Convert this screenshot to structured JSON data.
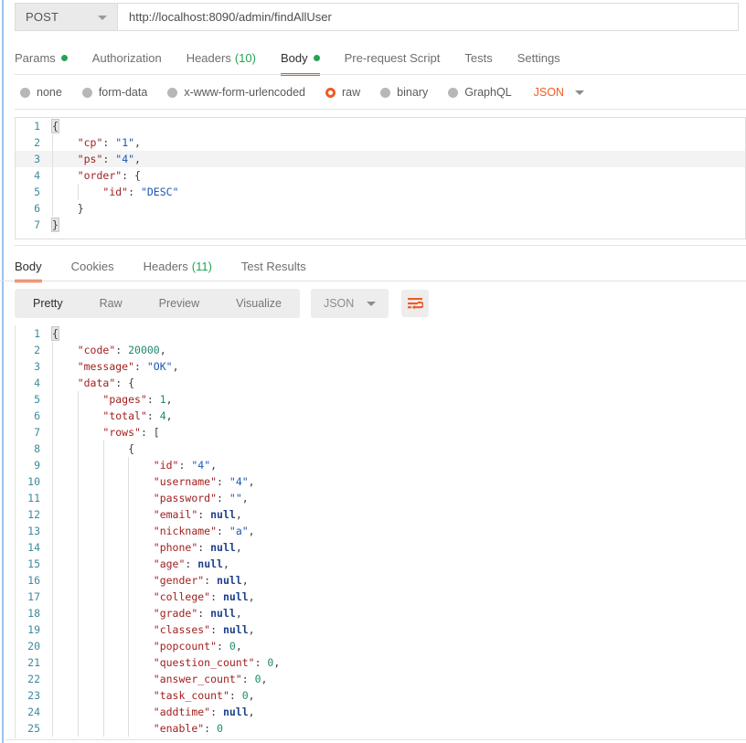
{
  "request": {
    "method": "POST",
    "method_icon": "chevron-down-icon",
    "url": "http://localhost:8090/admin/findAllUser",
    "tabs": [
      {
        "label": "Params",
        "dot": true,
        "active": false
      },
      {
        "label": "Authorization",
        "dot": false,
        "active": false
      },
      {
        "label": "Headers",
        "count": "(10)",
        "dot": false,
        "active": false
      },
      {
        "label": "Body",
        "dot": true,
        "active": true
      },
      {
        "label": "Pre-request Script",
        "dot": false,
        "active": false
      },
      {
        "label": "Tests",
        "dot": false,
        "active": false
      },
      {
        "label": "Settings",
        "dot": false,
        "active": false
      }
    ],
    "body_types": [
      {
        "label": "none",
        "selected": false
      },
      {
        "label": "form-data",
        "selected": false
      },
      {
        "label": "x-www-form-urlencoded",
        "selected": false
      },
      {
        "label": "raw",
        "selected": true
      },
      {
        "label": "binary",
        "selected": false
      },
      {
        "label": "GraphQL",
        "selected": false
      }
    ],
    "format": "JSON",
    "format_icon": "chevron-down-icon",
    "body_lines": [
      {
        "n": "1",
        "active": false,
        "guides": 0,
        "tokens": [
          {
            "t": "{",
            "c": "box"
          }
        ]
      },
      {
        "n": "2",
        "active": false,
        "guides": 1,
        "tokens": [
          {
            "t": "    ",
            "c": "p"
          },
          {
            "t": "\"cp\"",
            "c": "k"
          },
          {
            "t": ": ",
            "c": "p"
          },
          {
            "t": "\"1\"",
            "c": "s"
          },
          {
            "t": ",",
            "c": "p"
          }
        ]
      },
      {
        "n": "3",
        "active": true,
        "guides": 1,
        "tokens": [
          {
            "t": "    ",
            "c": "p"
          },
          {
            "t": "\"ps\"",
            "c": "k"
          },
          {
            "t": ": ",
            "c": "p"
          },
          {
            "t": "\"4\"",
            "c": "s"
          },
          {
            "t": ",",
            "c": "p"
          }
        ]
      },
      {
        "n": "4",
        "active": false,
        "guides": 1,
        "tokens": [
          {
            "t": "    ",
            "c": "p"
          },
          {
            "t": "\"order\"",
            "c": "k"
          },
          {
            "t": ": {",
            "c": "p"
          }
        ]
      },
      {
        "n": "5",
        "active": false,
        "guides": 2,
        "tokens": [
          {
            "t": "        ",
            "c": "p"
          },
          {
            "t": "\"id\"",
            "c": "k"
          },
          {
            "t": ": ",
            "c": "p"
          },
          {
            "t": "\"DESC\"",
            "c": "s"
          }
        ]
      },
      {
        "n": "6",
        "active": false,
        "guides": 1,
        "tokens": [
          {
            "t": "    ",
            "c": "p"
          },
          {
            "t": "}",
            "c": "p"
          }
        ]
      },
      {
        "n": "7",
        "active": false,
        "guides": 0,
        "tokens": [
          {
            "t": "}",
            "c": "box"
          }
        ]
      }
    ]
  },
  "response": {
    "tabs": [
      {
        "label": "Body",
        "active": true
      },
      {
        "label": "Cookies",
        "active": false
      },
      {
        "label": "Headers",
        "count": "(11)",
        "active": false
      },
      {
        "label": "Test Results",
        "active": false
      }
    ],
    "view_modes": [
      {
        "label": "Pretty",
        "active": true
      },
      {
        "label": "Raw",
        "active": false
      },
      {
        "label": "Preview",
        "active": false
      },
      {
        "label": "Visualize",
        "active": false
      }
    ],
    "format": "JSON",
    "format_icon": "chevron-down-icon",
    "wrap_icon": "word-wrap-icon",
    "body_lines": [
      {
        "n": "1",
        "guides": 0,
        "tokens": [
          {
            "t": "{",
            "c": "box"
          }
        ]
      },
      {
        "n": "2",
        "guides": 1,
        "tokens": [
          {
            "t": "    ",
            "c": "p"
          },
          {
            "t": "\"code\"",
            "c": "k"
          },
          {
            "t": ": ",
            "c": "p"
          },
          {
            "t": "20000",
            "c": "n"
          },
          {
            "t": ",",
            "c": "p"
          }
        ]
      },
      {
        "n": "3",
        "guides": 1,
        "tokens": [
          {
            "t": "    ",
            "c": "p"
          },
          {
            "t": "\"message\"",
            "c": "k"
          },
          {
            "t": ": ",
            "c": "p"
          },
          {
            "t": "\"OK\"",
            "c": "s"
          },
          {
            "t": ",",
            "c": "p"
          }
        ]
      },
      {
        "n": "4",
        "guides": 1,
        "tokens": [
          {
            "t": "    ",
            "c": "p"
          },
          {
            "t": "\"data\"",
            "c": "k"
          },
          {
            "t": ": {",
            "c": "p"
          }
        ]
      },
      {
        "n": "5",
        "guides": 2,
        "tokens": [
          {
            "t": "        ",
            "c": "p"
          },
          {
            "t": "\"pages\"",
            "c": "k"
          },
          {
            "t": ": ",
            "c": "p"
          },
          {
            "t": "1",
            "c": "n"
          },
          {
            "t": ",",
            "c": "p"
          }
        ]
      },
      {
        "n": "6",
        "guides": 2,
        "tokens": [
          {
            "t": "        ",
            "c": "p"
          },
          {
            "t": "\"total\"",
            "c": "k"
          },
          {
            "t": ": ",
            "c": "p"
          },
          {
            "t": "4",
            "c": "n"
          },
          {
            "t": ",",
            "c": "p"
          }
        ]
      },
      {
        "n": "7",
        "guides": 2,
        "tokens": [
          {
            "t": "        ",
            "c": "p"
          },
          {
            "t": "\"rows\"",
            "c": "k"
          },
          {
            "t": ": [",
            "c": "p"
          }
        ]
      },
      {
        "n": "8",
        "guides": 3,
        "tokens": [
          {
            "t": "            ",
            "c": "p"
          },
          {
            "t": "{",
            "c": "p"
          }
        ]
      },
      {
        "n": "9",
        "guides": 4,
        "tokens": [
          {
            "t": "                ",
            "c": "p"
          },
          {
            "t": "\"id\"",
            "c": "k"
          },
          {
            "t": ": ",
            "c": "p"
          },
          {
            "t": "\"4\"",
            "c": "s"
          },
          {
            "t": ",",
            "c": "p"
          }
        ]
      },
      {
        "n": "10",
        "guides": 4,
        "tokens": [
          {
            "t": "                ",
            "c": "p"
          },
          {
            "t": "\"username\"",
            "c": "k"
          },
          {
            "t": ": ",
            "c": "p"
          },
          {
            "t": "\"4\"",
            "c": "s"
          },
          {
            "t": ",",
            "c": "p"
          }
        ]
      },
      {
        "n": "11",
        "guides": 4,
        "tokens": [
          {
            "t": "                ",
            "c": "p"
          },
          {
            "t": "\"password\"",
            "c": "k"
          },
          {
            "t": ": ",
            "c": "p"
          },
          {
            "t": "\"\"",
            "c": "s"
          },
          {
            "t": ",",
            "c": "p"
          }
        ]
      },
      {
        "n": "12",
        "guides": 4,
        "tokens": [
          {
            "t": "                ",
            "c": "p"
          },
          {
            "t": "\"email\"",
            "c": "k"
          },
          {
            "t": ": ",
            "c": "p"
          },
          {
            "t": "null",
            "c": "nl"
          },
          {
            "t": ",",
            "c": "p"
          }
        ]
      },
      {
        "n": "13",
        "guides": 4,
        "tokens": [
          {
            "t": "                ",
            "c": "p"
          },
          {
            "t": "\"nickname\"",
            "c": "k"
          },
          {
            "t": ": ",
            "c": "p"
          },
          {
            "t": "\"a\"",
            "c": "s"
          },
          {
            "t": ",",
            "c": "p"
          }
        ]
      },
      {
        "n": "14",
        "guides": 4,
        "tokens": [
          {
            "t": "                ",
            "c": "p"
          },
          {
            "t": "\"phone\"",
            "c": "k"
          },
          {
            "t": ": ",
            "c": "p"
          },
          {
            "t": "null",
            "c": "nl"
          },
          {
            "t": ",",
            "c": "p"
          }
        ]
      },
      {
        "n": "15",
        "guides": 4,
        "tokens": [
          {
            "t": "                ",
            "c": "p"
          },
          {
            "t": "\"age\"",
            "c": "k"
          },
          {
            "t": ": ",
            "c": "p"
          },
          {
            "t": "null",
            "c": "nl"
          },
          {
            "t": ",",
            "c": "p"
          }
        ]
      },
      {
        "n": "16",
        "guides": 4,
        "tokens": [
          {
            "t": "                ",
            "c": "p"
          },
          {
            "t": "\"gender\"",
            "c": "k"
          },
          {
            "t": ": ",
            "c": "p"
          },
          {
            "t": "null",
            "c": "nl"
          },
          {
            "t": ",",
            "c": "p"
          }
        ]
      },
      {
        "n": "17",
        "guides": 4,
        "tokens": [
          {
            "t": "                ",
            "c": "p"
          },
          {
            "t": "\"college\"",
            "c": "k"
          },
          {
            "t": ": ",
            "c": "p"
          },
          {
            "t": "null",
            "c": "nl"
          },
          {
            "t": ",",
            "c": "p"
          }
        ]
      },
      {
        "n": "18",
        "guides": 4,
        "tokens": [
          {
            "t": "                ",
            "c": "p"
          },
          {
            "t": "\"grade\"",
            "c": "k"
          },
          {
            "t": ": ",
            "c": "p"
          },
          {
            "t": "null",
            "c": "nl"
          },
          {
            "t": ",",
            "c": "p"
          }
        ]
      },
      {
        "n": "19",
        "guides": 4,
        "tokens": [
          {
            "t": "                ",
            "c": "p"
          },
          {
            "t": "\"classes\"",
            "c": "k"
          },
          {
            "t": ": ",
            "c": "p"
          },
          {
            "t": "null",
            "c": "nl"
          },
          {
            "t": ",",
            "c": "p"
          }
        ]
      },
      {
        "n": "20",
        "guides": 4,
        "tokens": [
          {
            "t": "                ",
            "c": "p"
          },
          {
            "t": "\"popcount\"",
            "c": "k"
          },
          {
            "t": ": ",
            "c": "p"
          },
          {
            "t": "0",
            "c": "n"
          },
          {
            "t": ",",
            "c": "p"
          }
        ]
      },
      {
        "n": "21",
        "guides": 4,
        "tokens": [
          {
            "t": "                ",
            "c": "p"
          },
          {
            "t": "\"question_count\"",
            "c": "k"
          },
          {
            "t": ": ",
            "c": "p"
          },
          {
            "t": "0",
            "c": "n"
          },
          {
            "t": ",",
            "c": "p"
          }
        ]
      },
      {
        "n": "22",
        "guides": 4,
        "tokens": [
          {
            "t": "                ",
            "c": "p"
          },
          {
            "t": "\"answer_count\"",
            "c": "k"
          },
          {
            "t": ": ",
            "c": "p"
          },
          {
            "t": "0",
            "c": "n"
          },
          {
            "t": ",",
            "c": "p"
          }
        ]
      },
      {
        "n": "23",
        "guides": 4,
        "tokens": [
          {
            "t": "                ",
            "c": "p"
          },
          {
            "t": "\"task_count\"",
            "c": "k"
          },
          {
            "t": ": ",
            "c": "p"
          },
          {
            "t": "0",
            "c": "n"
          },
          {
            "t": ",",
            "c": "p"
          }
        ]
      },
      {
        "n": "24",
        "guides": 4,
        "tokens": [
          {
            "t": "                ",
            "c": "p"
          },
          {
            "t": "\"addtime\"",
            "c": "k"
          },
          {
            "t": ": ",
            "c": "p"
          },
          {
            "t": "null",
            "c": "nl"
          },
          {
            "t": ",",
            "c": "p"
          }
        ]
      },
      {
        "n": "25",
        "guides": 4,
        "tokens": [
          {
            "t": "                ",
            "c": "p"
          },
          {
            "t": "\"enable\"",
            "c": "k"
          },
          {
            "t": ": ",
            "c": "p"
          },
          {
            "t": "0",
            "c": "n"
          }
        ]
      }
    ]
  },
  "colors": {
    "accent": "#ef5b25",
    "success": "#23a455",
    "rail": "#9dc1e6"
  }
}
